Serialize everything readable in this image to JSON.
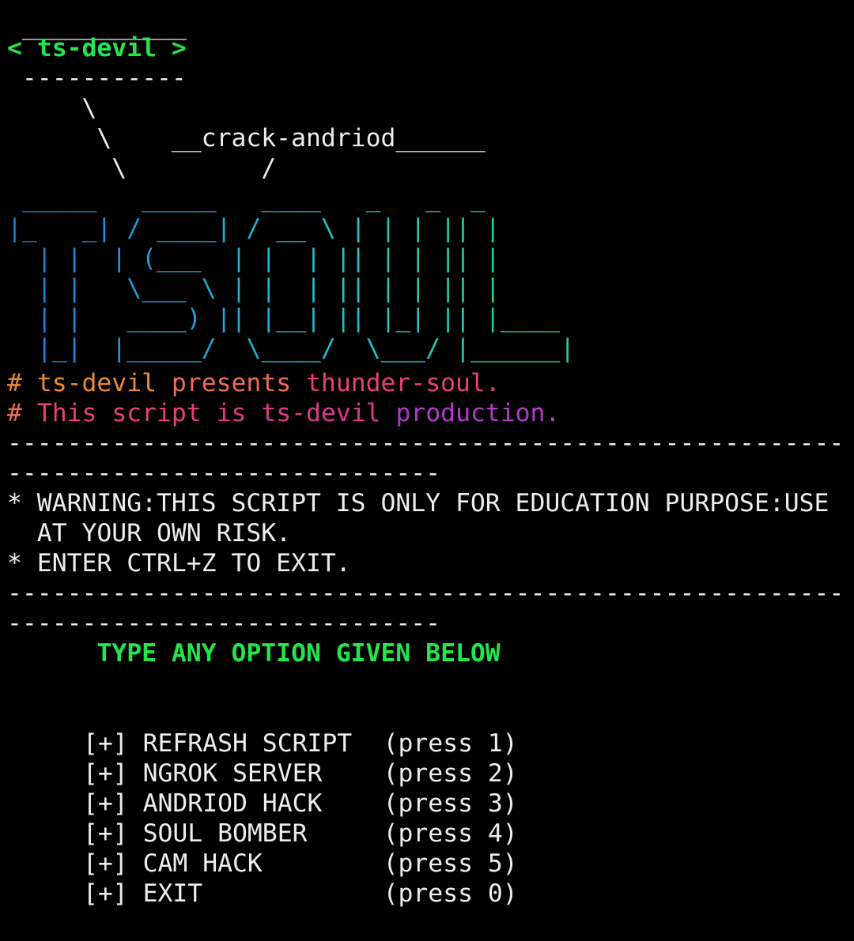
{
  "cowsay": {
    "top_border": " ___________",
    "bubble": "< ts-devil >",
    "bottom_border": " -----------",
    "stem1": "     \\",
    "stem2": "      \\    __crack-andriod______",
    "stem3": "       \\         /"
  },
  "banner_art": [
    " _____   _____   ____   _   _  _",
    "|_   _| / ____| / __ \\ | | | || |",
    "  | |  | (___  | |  | || | | || |",
    "  | |   \\___ \\ | |  | || | | || |",
    "  | |   ____) || |__| || |_| || |____",
    "  |_|  |_____/  \\____/  \\___/ |______|"
  ],
  "info": {
    "line1_hash": "#",
    "line1_a": "ts-devil",
    "line1_b": "presents",
    "line1_c": "thunder-soul.",
    "line2_hash": "#",
    "line2_a": "This",
    "line2_b": "script",
    "line2_c": "is",
    "line2_d": "ts-devil",
    "line2_e": "production."
  },
  "separator_long": "----------------------------------------------------------------------------------------------------",
  "separator_full": "---------------------------------------------------------",
  "separator_tail": "-----------------------------",
  "warnings": {
    "w1_line1": "* WARNING:THIS SCRIPT IS ONLY FOR EDUCATION PURPOSE:USE",
    "w1_line2": "  AT YOUR OWN RISK.",
    "w2": "* ENTER CTRL+Z TO EXIT."
  },
  "prompt": "      TYPE ANY OPTION GIVEN BELOW",
  "menu": [
    {
      "bullet": "[+]",
      "label": "REFRASH SCRIPT",
      "hint": "(press 1)"
    },
    {
      "bullet": "[+]",
      "label": "NGROK SERVER",
      "hint": "(press 2)"
    },
    {
      "bullet": "[+]",
      "label": "ANDRIOD HACK",
      "hint": "(press 3)"
    },
    {
      "bullet": "[+]",
      "label": "SOUL BOMBER",
      "hint": "(press 4)"
    },
    {
      "bullet": "[+]",
      "label": "CAM HACK",
      "hint": "(press 5)"
    },
    {
      "bullet": "[+]",
      "label": "EXIT",
      "hint": "(press 0)"
    }
  ]
}
